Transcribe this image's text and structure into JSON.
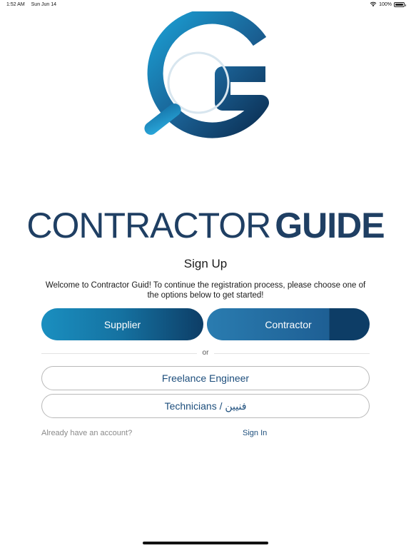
{
  "status_bar": {
    "time": "1:52 AM",
    "date": "Sun Jun 14",
    "battery": "100%",
    "icons": [
      "wifi-icon",
      "battery-icon"
    ]
  },
  "logo": {
    "icon": "contractor-guide-g-magnifier-logo",
    "word_1": "CONTRACTOR",
    "word_2": "GUIDE",
    "colors": {
      "brand_light": "#1a9fd4",
      "brand_dark": "#0d3d66"
    }
  },
  "title": "Sign Up",
  "welcome": "Welcome to Contractor Guid! To continue the registration process, please choose one of the options below to get started!",
  "roles": {
    "supplier": "Supplier",
    "contractor": "Contractor"
  },
  "separator": "or",
  "options": {
    "freelance": "Freelance Engineer",
    "technicians": "Technicians / فنيين"
  },
  "footer": {
    "prompt": "Already have an account?",
    "signin": "Sign In"
  },
  "colors": {
    "accent": "#1d4e7c",
    "primary_button": "#1a8fc0"
  }
}
